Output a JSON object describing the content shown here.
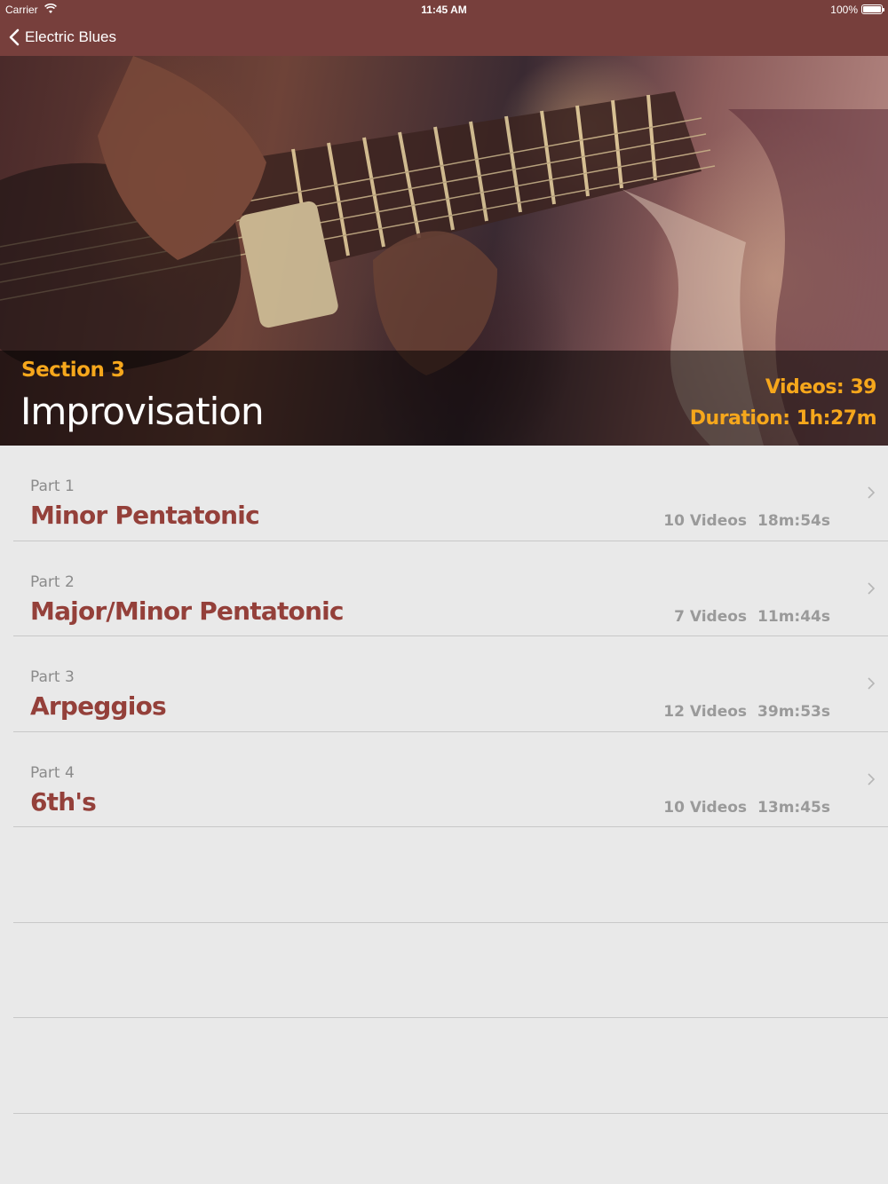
{
  "status_bar": {
    "carrier": "Carrier",
    "time": "11:45 AM",
    "battery": "100%"
  },
  "nav": {
    "back_label": "Electric Blues"
  },
  "header": {
    "section_label": "Section 3",
    "title": "Improvisation",
    "videos": "Videos: 39",
    "duration": "Duration: 1h:27m"
  },
  "parts": [
    {
      "part": "Part 1",
      "title": "Minor Pentatonic",
      "videos": "10 Videos",
      "duration": "18m:54s"
    },
    {
      "part": "Part 2",
      "title": "Major/Minor Pentatonic",
      "videos": "7 Videos",
      "duration": "11m:44s"
    },
    {
      "part": "Part 3",
      "title": "Arpeggios",
      "videos": "12 Videos",
      "duration": "39m:53s"
    },
    {
      "part": "Part 4",
      "title": "6th's",
      "videos": "10 Videos",
      "duration": "13m:45s"
    }
  ],
  "colors": {
    "nav_bar": "#773f3c",
    "accent_orange": "#f6a71c",
    "title_red": "#94403a",
    "background": "#e9e9e9"
  }
}
